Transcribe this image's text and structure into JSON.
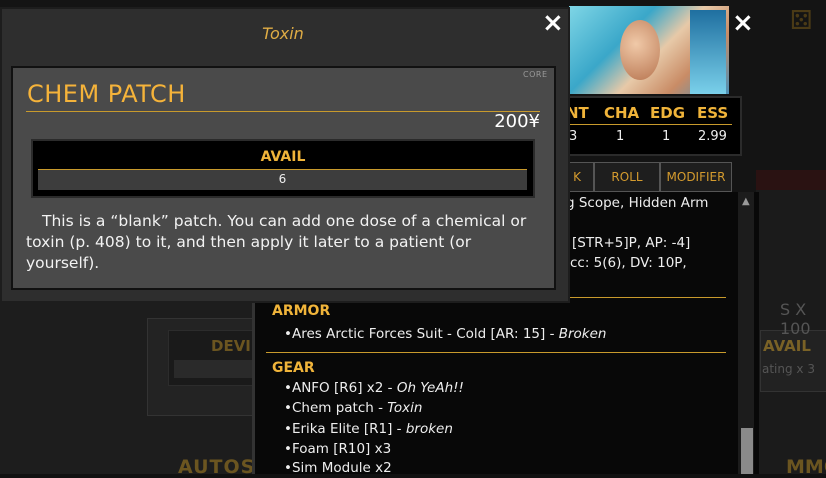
{
  "modal": {
    "title": "Toxin",
    "close": "×",
    "source": "CORE",
    "item_name": "CHEM PATCH",
    "price": "200¥",
    "avail_label": "AVAIL",
    "avail_value": "6",
    "description": "This is a “blank” patch. You can add one dose of a chemical or toxin (p. 408) to it, and then apply it later to a patient (or yourself)."
  },
  "character_card": {
    "close": "×",
    "stats": [
      {
        "label": "NT",
        "value": "3"
      },
      {
        "label": "CHA",
        "value": "1"
      },
      {
        "label": "EDG",
        "value": "1"
      },
      {
        "label": "ESS",
        "value": "2.99"
      }
    ],
    "buttons": [
      "K",
      "ROLL",
      "MODIFIER"
    ]
  },
  "list": {
    "partial_lines": [
      "g Scope, Hidden Arm",
      "[STR+5]P, AP: -4]",
      "cc: 5(6), DV: 10P,"
    ],
    "armor_heading": "ARMOR",
    "armor_items": [
      {
        "text": "•Ares Arctic Forces Suit - Cold [AR: 15] - ",
        "note": "Broken"
      }
    ],
    "gear_heading": "GEAR",
    "gear_items": [
      {
        "text": "•ANFO [R6] x2 - ",
        "note": "Oh YeAh!!"
      },
      {
        "text": "•Chem patch - ",
        "note": "Toxin"
      },
      {
        "text": "•Erika Elite [R1] - ",
        "note": "broken"
      },
      {
        "text": "•Foam [R10] x3",
        "note": ""
      },
      {
        "text": "•Sim Module x2",
        "note": ""
      }
    ]
  },
  "background": {
    "device_label": "DEVI",
    "autos_label": "AUTOS",
    "gs_label": "S X 100",
    "avail_label": "AVAIL",
    "rating_label": "ating x 3",
    "ammo_label": "MMON"
  },
  "colors": {
    "accent": "#f0b43a",
    "modal_bg": "#2e2e2e",
    "inner_bg": "#4a4a4a"
  }
}
